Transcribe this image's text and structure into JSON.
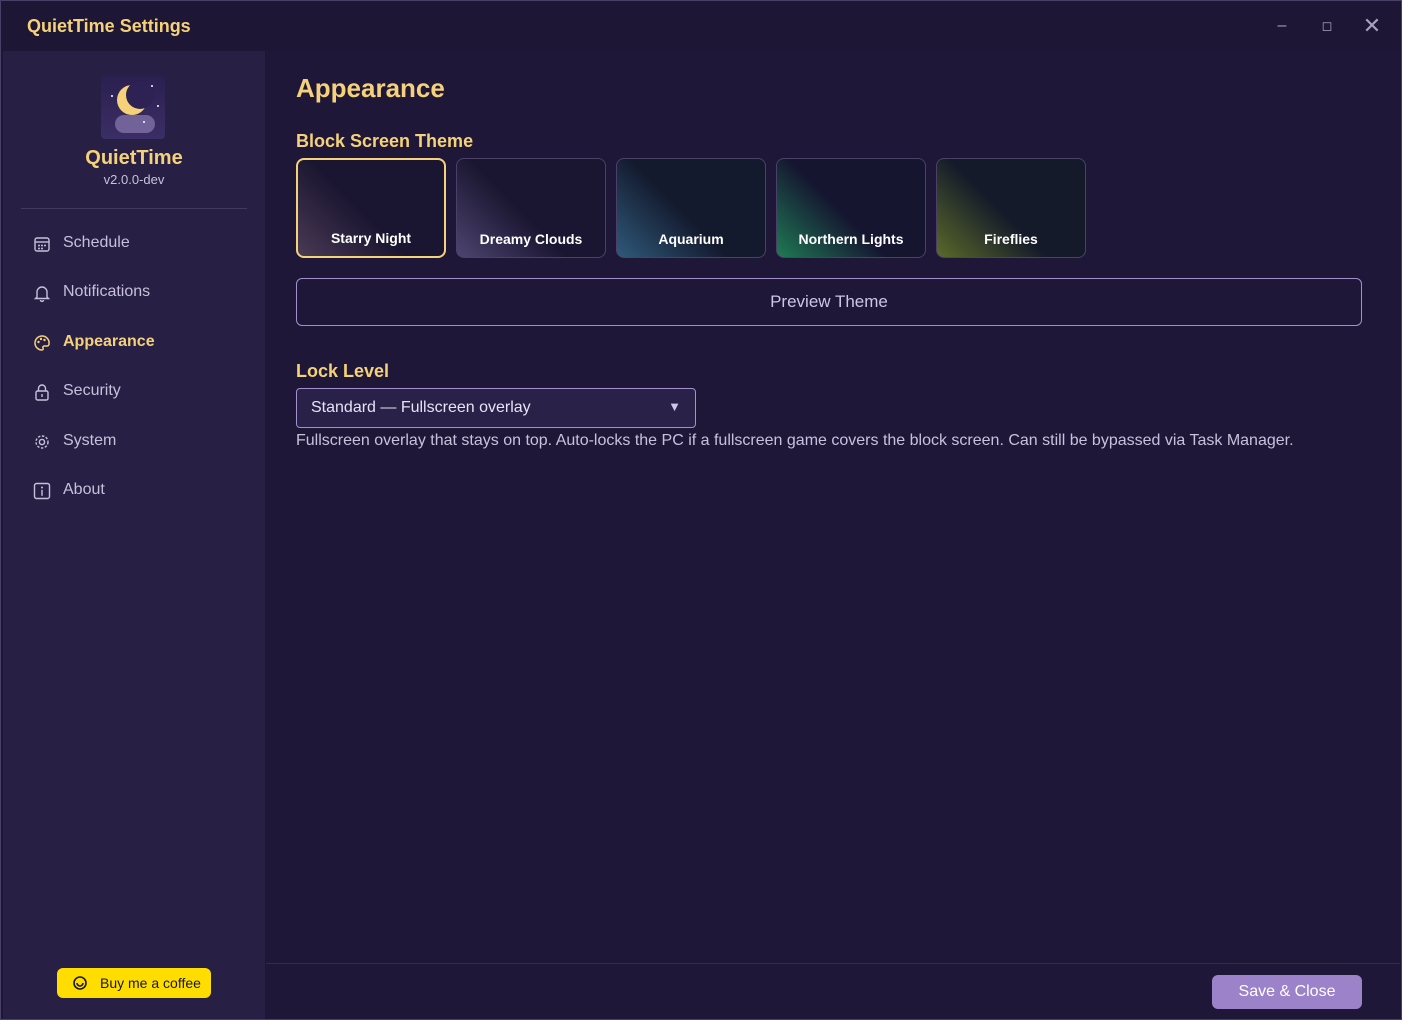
{
  "window": {
    "title": "QuietTime Settings",
    "minimize_glyph": "–",
    "maximize_glyph": "◻",
    "close_glyph": "✕"
  },
  "sidebar": {
    "app_name": "QuietTime",
    "version": "v2.0.0-dev",
    "items": [
      {
        "label": "Schedule",
        "icon": "calendar-icon"
      },
      {
        "label": "Notifications",
        "icon": "bell-icon"
      },
      {
        "label": "Appearance",
        "icon": "palette-icon",
        "active": true
      },
      {
        "label": "Security",
        "icon": "lock-icon"
      },
      {
        "label": "System",
        "icon": "gear-icon"
      },
      {
        "label": "About",
        "icon": "info-icon"
      }
    ],
    "coffee_label": "Buy me a coffee"
  },
  "main": {
    "page_title": "Appearance",
    "theme_section_title": "Block Screen Theme",
    "themes": [
      {
        "name": "Starry Night",
        "selected": true,
        "accent": "#4a3a55"
      },
      {
        "name": "Dreamy Clouds",
        "accent": "#4d4570"
      },
      {
        "name": "Aquarium",
        "accent": "#2f5a7a"
      },
      {
        "name": "Northern Lights",
        "accent": "#1f7a55"
      },
      {
        "name": "Fireflies",
        "accent": "#5a6a2a"
      }
    ],
    "preview_button": "Preview Theme",
    "lock_section_title": "Lock Level",
    "lock_level_value": "Standard — Fullscreen overlay",
    "lock_level_description": "Fullscreen overlay that stays on top. Auto-locks the PC if a fullscreen game covers the block screen. Can still be bypassed via Task Manager.",
    "save_button": "Save & Close"
  },
  "colors": {
    "accent_gold": "#f5d27a",
    "sidebar_bg": "#281f45",
    "main_bg": "#1e1738",
    "button_purple": "#9c82c9",
    "coffee_yellow": "#ffdd00"
  }
}
